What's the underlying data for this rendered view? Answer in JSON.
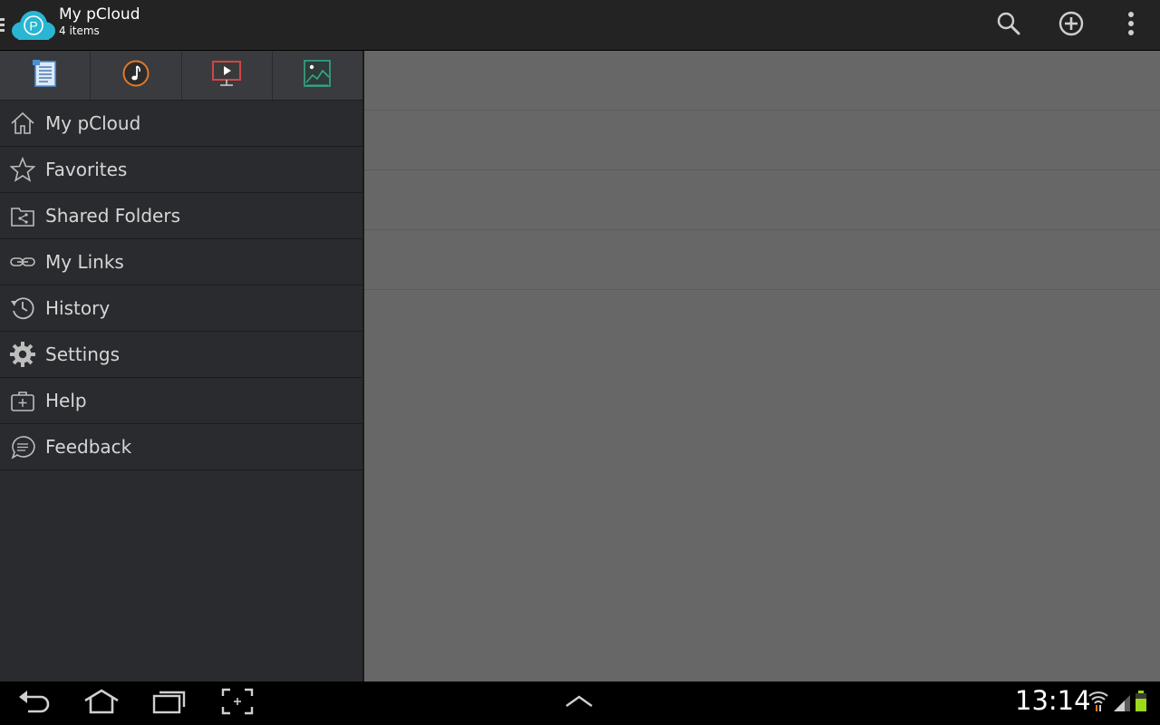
{
  "header": {
    "title": "My pCloud",
    "subtitle": "4 items",
    "logo_letter": "P",
    "actions": [
      {
        "name": "search",
        "icon": "search-icon"
      },
      {
        "name": "add",
        "icon": "plus-circle-icon"
      },
      {
        "name": "overflow",
        "icon": "more-vert-icon"
      }
    ]
  },
  "category_tabs": [
    {
      "name": "documents",
      "icon": "document-icon",
      "color": "#4a8fd9"
    },
    {
      "name": "audio",
      "icon": "music-icon",
      "color": "#e0782b"
    },
    {
      "name": "video",
      "icon": "video-icon",
      "color": "#d24545"
    },
    {
      "name": "images",
      "icon": "image-icon",
      "color": "#33a88a"
    }
  ],
  "nav": {
    "items": [
      {
        "label": "My pCloud",
        "icon": "home-icon"
      },
      {
        "label": "Favorites",
        "icon": "star-icon"
      },
      {
        "label": "Shared Folders",
        "icon": "shared-folder-icon"
      },
      {
        "label": "My Links",
        "icon": "link-icon"
      },
      {
        "label": "History",
        "icon": "history-icon"
      },
      {
        "label": "Settings",
        "icon": "gear-icon"
      },
      {
        "label": "Help",
        "icon": "help-icon"
      },
      {
        "label": "Feedback",
        "icon": "feedback-icon"
      }
    ]
  },
  "system": {
    "time": "13:14",
    "buttons": [
      "back-icon",
      "home-icon",
      "recents-icon",
      "screenshot-icon",
      "chevron-up-icon"
    ],
    "status_icons": [
      "wifi-icon",
      "signal-icon",
      "battery-icon"
    ]
  },
  "colors": {
    "accent": "#29b6d4",
    "actionbar": "#232323",
    "sidebar": "#2a2b2e",
    "content": "#676767"
  }
}
